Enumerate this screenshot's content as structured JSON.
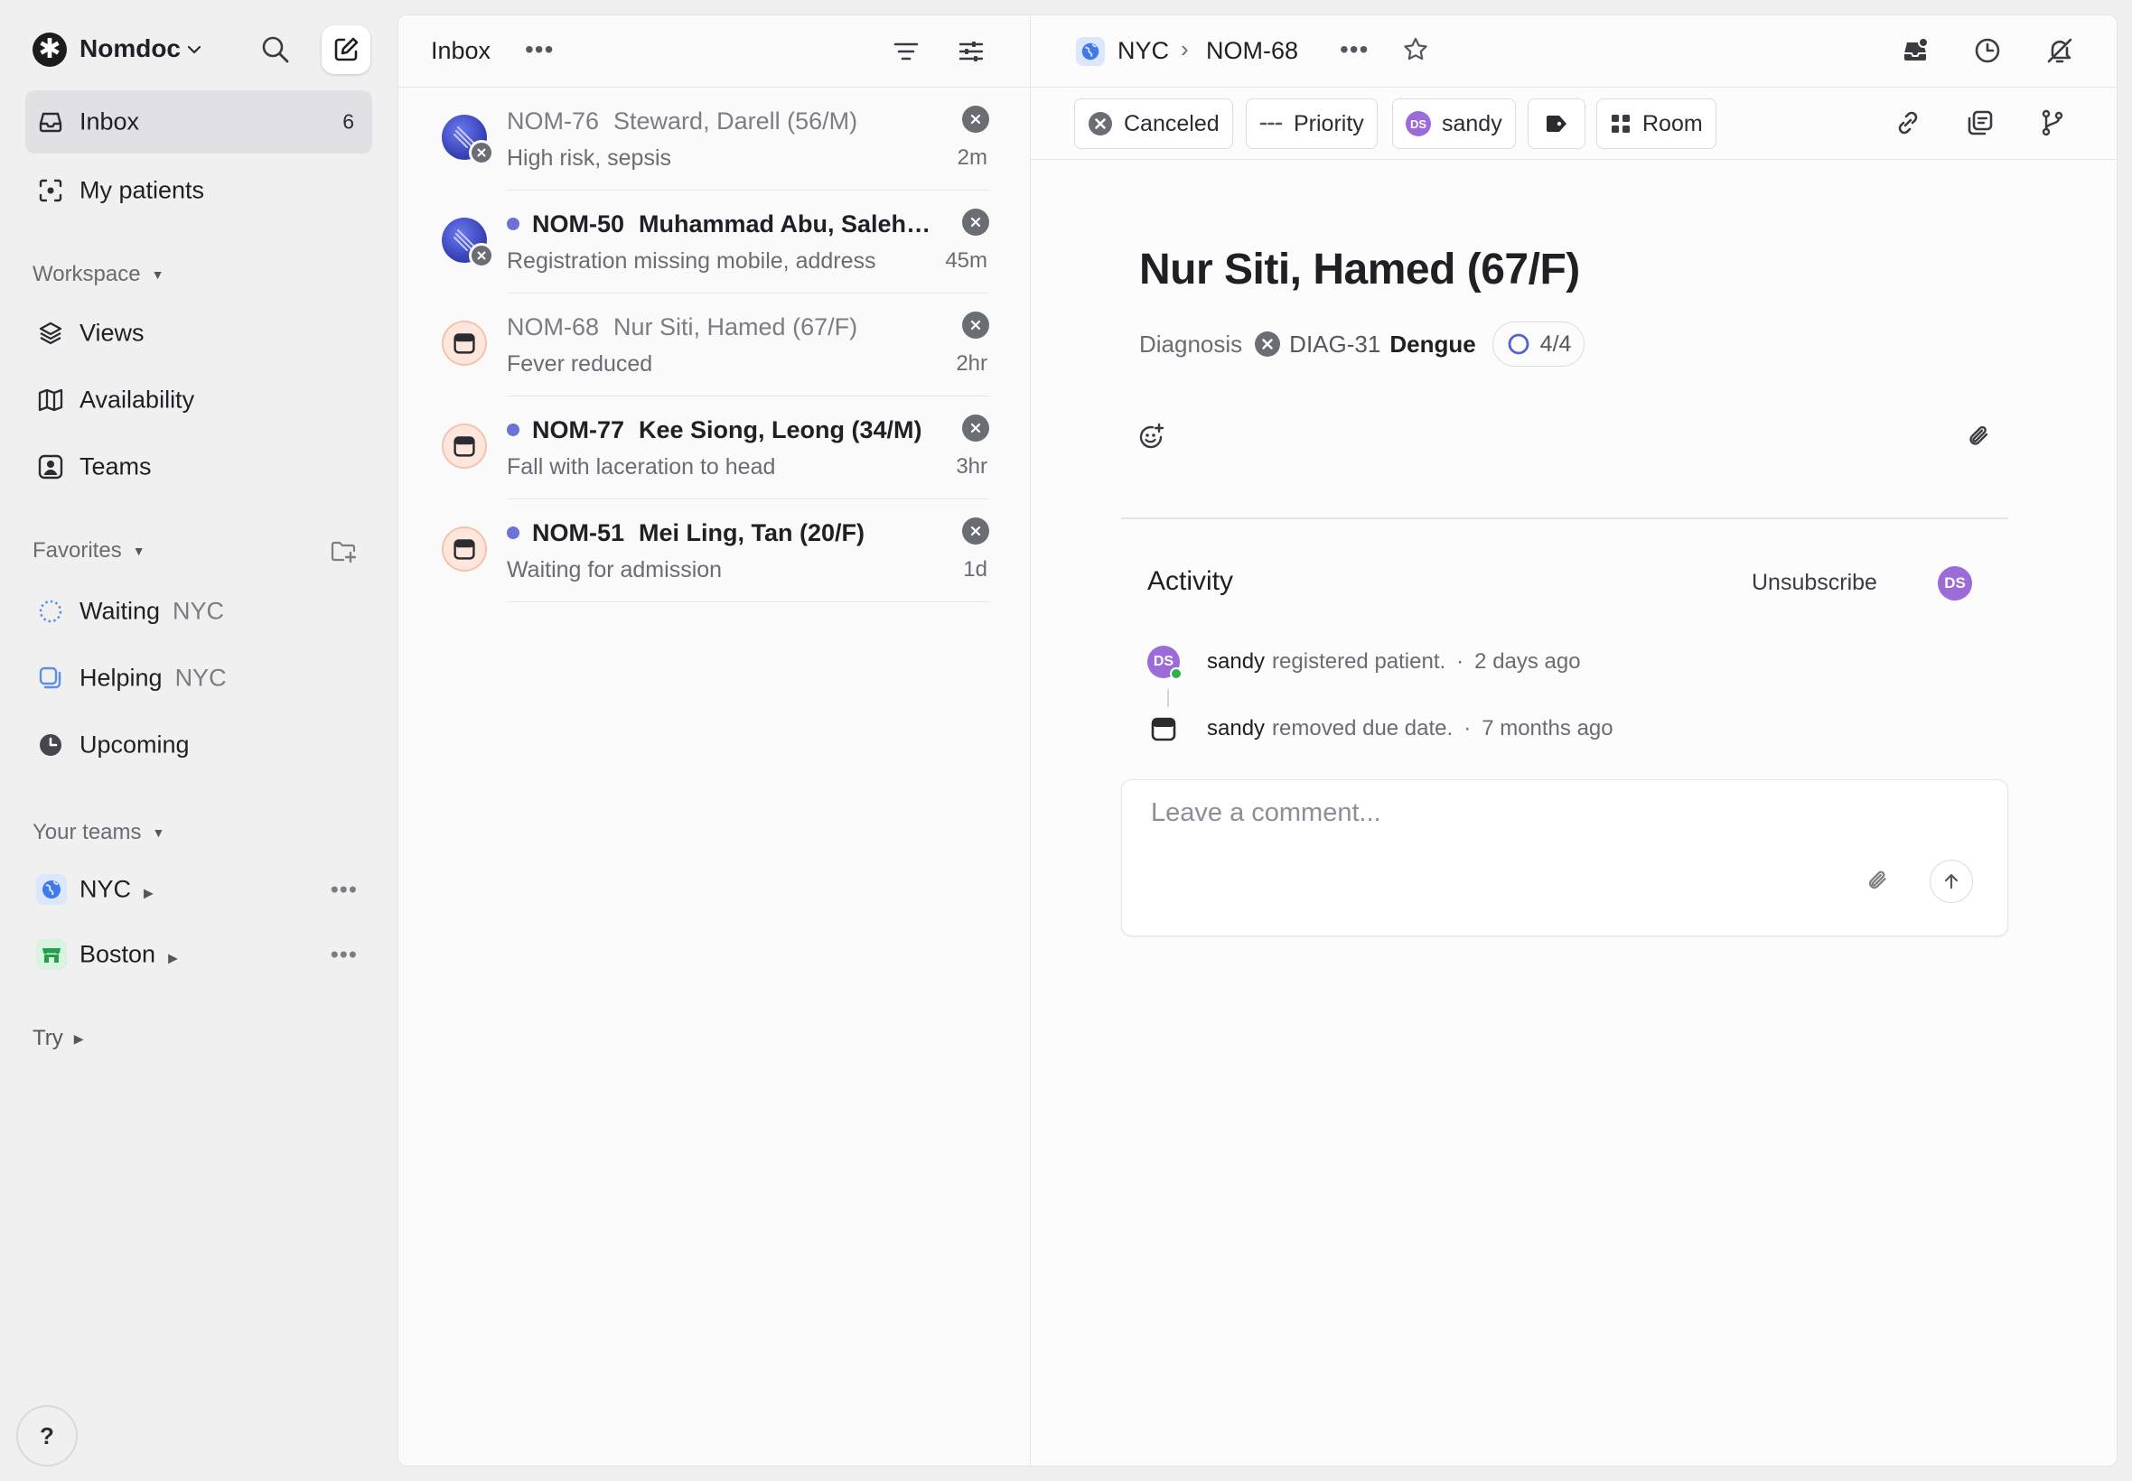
{
  "workspace": {
    "name": "Nomdoc"
  },
  "sidebar": {
    "inbox": {
      "label": "Inbox",
      "count": "6"
    },
    "my_patients": {
      "label": "My patients"
    },
    "workspace_header": "Workspace",
    "workspace_items": [
      {
        "label": "Views",
        "icon": "layers-icon"
      },
      {
        "label": "Availability",
        "icon": "map-icon"
      },
      {
        "label": "Teams",
        "icon": "teams-icon"
      }
    ],
    "favorites_header": "Favorites",
    "favorites": [
      {
        "label": "Waiting",
        "team": "NYC",
        "icon": "dotted-circle-icon"
      },
      {
        "label": "Helping",
        "team": "NYC",
        "icon": "copy-square-icon"
      },
      {
        "label": "Upcoming",
        "team": "",
        "icon": "clock-icon"
      }
    ],
    "teams_header": "Your teams",
    "teams": [
      {
        "label": "NYC",
        "icon": "globe-icon",
        "color": "#3f7ae8"
      },
      {
        "label": "Boston",
        "icon": "storefront-icon",
        "color": "#22a04b"
      }
    ],
    "try_label": "Try",
    "help_label": "?"
  },
  "inbox": {
    "title": "Inbox",
    "items": [
      {
        "id": "NOM-76",
        "name": "Steward, Darell (56/M)",
        "subtitle": "High risk, sepsis",
        "time": "2m",
        "unread": false,
        "avatar": "org"
      },
      {
        "id": "NOM-50",
        "name": "Muhammad Abu, Saleh (4...",
        "subtitle": "Registration missing mobile, address",
        "time": "45m",
        "unread": true,
        "avatar": "org"
      },
      {
        "id": "NOM-68",
        "name": "Nur Siti, Hamed (67/F)",
        "subtitle": "Fever reduced",
        "time": "2hr",
        "unread": false,
        "avatar": "bed"
      },
      {
        "id": "NOM-77",
        "name": "Kee Siong, Leong (34/M)",
        "subtitle": "Fall with laceration to head",
        "time": "3hr",
        "unread": true,
        "avatar": "bed"
      },
      {
        "id": "NOM-51",
        "name": "Mei Ling, Tan (20/F)",
        "subtitle": "Waiting for admission",
        "time": "1d",
        "unread": true,
        "avatar": "bed"
      }
    ]
  },
  "detail": {
    "breadcrumb": {
      "team": "NYC",
      "issue": "NOM-68"
    },
    "properties": {
      "status": "Canceled",
      "priority": "Priority",
      "assignee": "sandy",
      "assignee_initials": "DS",
      "room": "Room"
    },
    "title": "Nur Siti, Hamed (67/F)",
    "diagnosis": {
      "label": "Diagnosis",
      "id": "DIAG-31",
      "name": "Dengue",
      "progress": "4/4"
    },
    "activity": {
      "title": "Activity",
      "unsubscribe": "Unsubscribe",
      "subscriber_initials": "DS",
      "items": [
        {
          "who": "sandy",
          "action": "registered patient.",
          "when": "2 days ago",
          "initials": "DS"
        },
        {
          "who": "sandy",
          "action": "removed due date.",
          "when": "7 months ago"
        }
      ]
    },
    "comment": {
      "placeholder": "Leave a comment..."
    }
  },
  "colors": {
    "accent": "#6d72d6",
    "assignee": "#9b6bd8",
    "status_gray": "#6a6d74"
  }
}
